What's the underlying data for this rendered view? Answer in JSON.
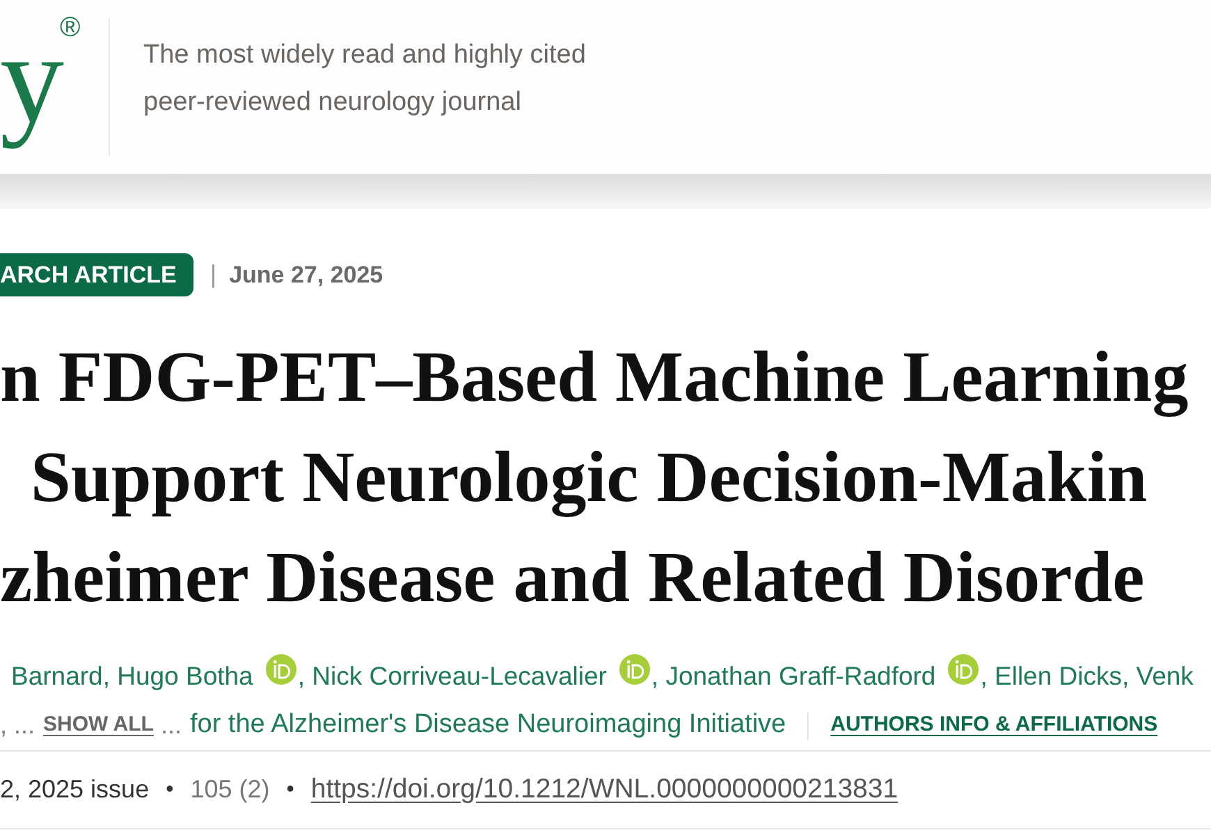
{
  "header": {
    "logo": {
      "text": "y",
      "mark": "®"
    },
    "tagline_lines": [
      "The most widely read and highly cited",
      "peer-reviewed neurology journal"
    ]
  },
  "article": {
    "type_badge": "ARCH ARTICLE",
    "date_separator": "|",
    "date": "June 27, 2025",
    "title_lines": [
      "n FDG-PET–Based Machine Learning",
      "Support Neurologic Decision-Makin",
      "zheimer Disease and Related Disorde"
    ],
    "author_separator": ", ",
    "authors": [
      {
        "name": "Barnard",
        "orcid": false
      },
      {
        "name": "Hugo Botha",
        "orcid": true
      },
      {
        "name": "Nick Corriveau-Lecavalier",
        "orcid": true
      },
      {
        "name": "Jonathan Graff-Radford",
        "orcid": true
      },
      {
        "name": "Ellen Dicks",
        "orcid": false
      },
      {
        "name": "Venk",
        "orcid": false
      }
    ],
    "authors_more": {
      "leading": ", ...",
      "show_all": "SHOW ALL",
      "trailing": "...",
      "group": "for the Alzheimer's Disease Neuroimaging Initiative",
      "info_link": "AUTHORS INFO & AFFILIATIONS"
    },
    "meta_separator": "•",
    "meta": [
      {
        "kind": "issue",
        "text": "2, 2025 issue"
      },
      {
        "kind": "volume",
        "text": "105 (2)"
      },
      {
        "kind": "doi",
        "text": "https://doi.org/10.1212/WNL.0000000000213831"
      }
    ]
  }
}
